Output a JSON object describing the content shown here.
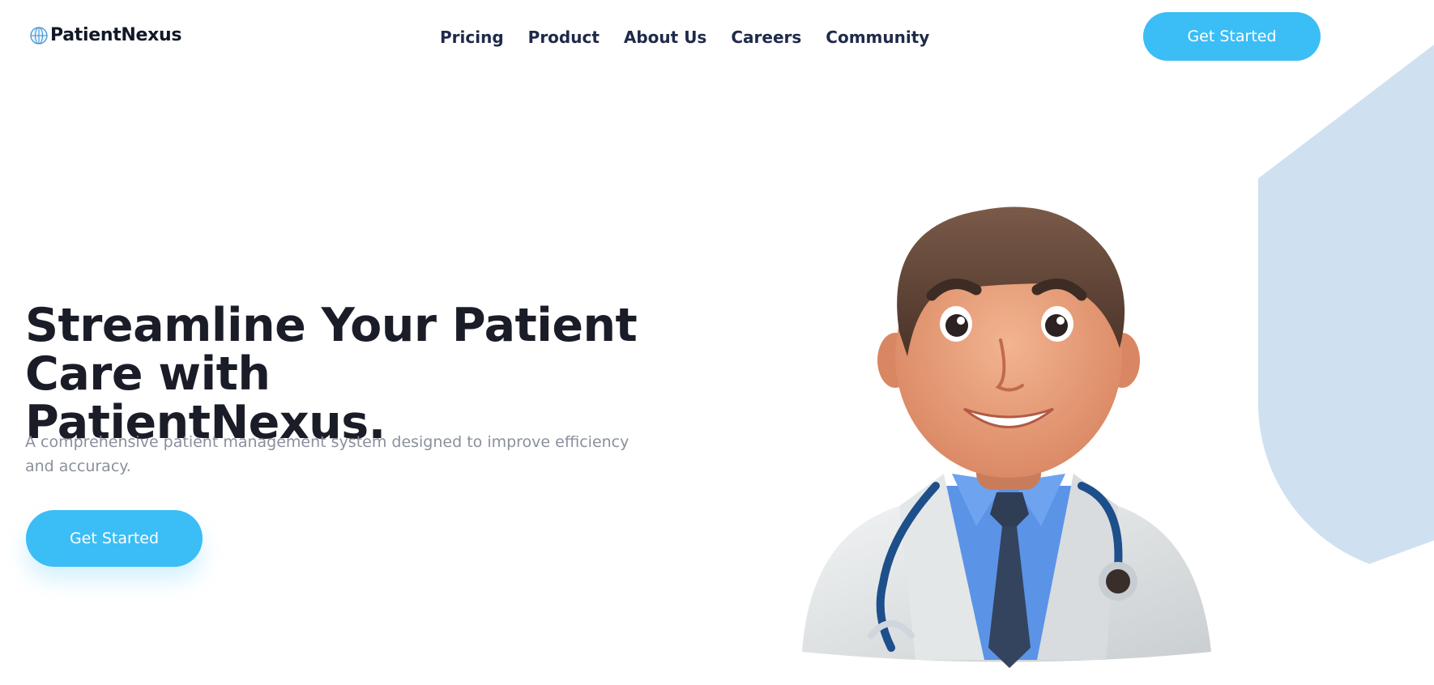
{
  "brand": {
    "name": "PatientNexus",
    "logo_icon": "globe-icon"
  },
  "nav": {
    "items": [
      {
        "label": "Pricing"
      },
      {
        "label": "Product"
      },
      {
        "label": "About Us"
      },
      {
        "label": "Careers"
      },
      {
        "label": "Community"
      }
    ],
    "cta_label": "Get Started"
  },
  "hero": {
    "title_line1": "Streamline Your Patient",
    "title_line2": "Care with PatientNexus.",
    "subtitle": "A comprehensive patient management system designed to improve efficiency and accuracy.",
    "cta_label": "Get Started",
    "illustration": "doctor-avatar-illustration"
  },
  "colors": {
    "accent": "#3bbdf6",
    "nav_text": "#1f2a4a",
    "heading": "#1a1c28",
    "muted": "#8a909c",
    "decor": "#cfe1f0"
  }
}
